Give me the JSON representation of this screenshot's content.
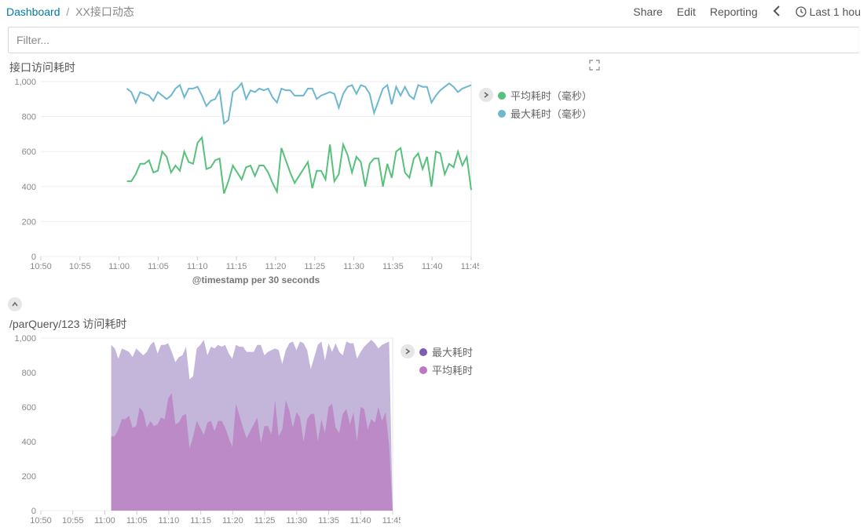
{
  "header": {
    "dashboard_link": "Dashboard",
    "separator": "/",
    "page_title": "XX接口动态",
    "actions": {
      "share": "Share",
      "edit": "Edit",
      "reporting": "Reporting",
      "time_range": "Last 1 hou"
    }
  },
  "filter": {
    "placeholder": "Filter..."
  },
  "panel1": {
    "title": "接口访问耗时",
    "x_axis_title": "@timestamp per 30 seconds",
    "legend": [
      {
        "label": "平均耗时（毫秒）",
        "color": "#57c17b"
      },
      {
        "label": "最大耗时（毫秒）",
        "color": "#6db7d0"
      }
    ]
  },
  "panel2": {
    "title": "/parQuery/123 访问耗时",
    "legend": [
      {
        "label": "最大耗时",
        "color": "#7c5eb0"
      },
      {
        "label": "平均耗时",
        "color": "#b97bbf"
      }
    ]
  },
  "chart_data": [
    {
      "type": "line",
      "title": "接口访问耗时",
      "xlabel": "@timestamp per 30 seconds",
      "ylabel": "",
      "ylim": [
        0,
        1000
      ],
      "x_ticks": [
        "10:50",
        "10:55",
        "11:00",
        "11:05",
        "11:10",
        "11:15",
        "11:20",
        "11:25",
        "11:30",
        "11:35",
        "11:40",
        "11:45"
      ],
      "series": [
        {
          "name": "平均耗时（毫秒）",
          "color": "#57c17b",
          "values": [
            430,
            430,
            470,
            530,
            530,
            550,
            480,
            490,
            600,
            570,
            480,
            520,
            490,
            600,
            540,
            530,
            650,
            680,
            500,
            510,
            550,
            560,
            360,
            430,
            520,
            480,
            440,
            510,
            520,
            460,
            520,
            520,
            480,
            420,
            370,
            620,
            550,
            480,
            420,
            460,
            500,
            540,
            390,
            490,
            490,
            440,
            640,
            430,
            470,
            640,
            580,
            480,
            570,
            540,
            400,
            530,
            560,
            560,
            400,
            530,
            450,
            600,
            620,
            480,
            450,
            560,
            590,
            500,
            570,
            400,
            600,
            590,
            470,
            530,
            510,
            600,
            520,
            570,
            380
          ]
        },
        {
          "name": "最大耗时（毫秒）",
          "color": "#6db7d0",
          "values": [
            960,
            940,
            880,
            940,
            930,
            920,
            890,
            940,
            920,
            900,
            920,
            960,
            980,
            910,
            960,
            960,
            970,
            920,
            860,
            890,
            900,
            950,
            760,
            780,
            940,
            960,
            990,
            900,
            950,
            940,
            960,
            950,
            960,
            910,
            880,
            960,
            950,
            950,
            920,
            920,
            920,
            960,
            960,
            900,
            920,
            930,
            940,
            930,
            850,
            930,
            970,
            980,
            930,
            980,
            970,
            930,
            820,
            890,
            960,
            980,
            870,
            970,
            920,
            970,
            920,
            900,
            980,
            970,
            970,
            880,
            920,
            950,
            970,
            990,
            970,
            940,
            960,
            970,
            980
          ]
        }
      ]
    },
    {
      "type": "area",
      "title": "/parQuery/123 访问耗时",
      "xlabel": "",
      "ylabel": "",
      "ylim": [
        0,
        1000
      ],
      "x_ticks": [
        "10:50",
        "10:55",
        "11:00",
        "11:05",
        "11:10",
        "11:15",
        "11:20",
        "11:25",
        "11:30",
        "11:35",
        "11:40",
        "11:45"
      ],
      "series": [
        {
          "name": "最大耗时",
          "color": "#7c5eb0",
          "values": [
            960,
            940,
            880,
            940,
            930,
            920,
            890,
            940,
            920,
            900,
            920,
            960,
            980,
            910,
            960,
            960,
            970,
            920,
            860,
            890,
            900,
            950,
            760,
            780,
            940,
            960,
            990,
            900,
            950,
            940,
            960,
            950,
            960,
            910,
            880,
            960,
            950,
            950,
            920,
            920,
            920,
            960,
            960,
            900,
            920,
            930,
            940,
            930,
            850,
            930,
            970,
            980,
            930,
            980,
            970,
            930,
            820,
            890,
            960,
            980,
            870,
            970,
            920,
            970,
            920,
            900,
            980,
            970,
            970,
            880,
            920,
            950,
            970,
            990,
            970,
            940,
            960,
            970,
            980,
            0
          ]
        },
        {
          "name": "平均耗时",
          "color": "#b97bbf",
          "values": [
            430,
            430,
            470,
            530,
            530,
            550,
            480,
            490,
            600,
            570,
            480,
            520,
            490,
            500,
            540,
            530,
            650,
            680,
            500,
            510,
            550,
            560,
            360,
            430,
            520,
            480,
            440,
            510,
            520,
            460,
            520,
            520,
            480,
            420,
            370,
            620,
            550,
            480,
            420,
            460,
            500,
            540,
            390,
            490,
            490,
            440,
            640,
            430,
            470,
            640,
            580,
            480,
            570,
            540,
            400,
            530,
            560,
            560,
            400,
            530,
            450,
            600,
            620,
            480,
            450,
            560,
            590,
            500,
            570,
            400,
            600,
            590,
            470,
            530,
            510,
            600,
            520,
            570,
            380,
            0
          ]
        }
      ]
    }
  ],
  "y_ticks": [
    0,
    200,
    400,
    600,
    800,
    1000
  ]
}
